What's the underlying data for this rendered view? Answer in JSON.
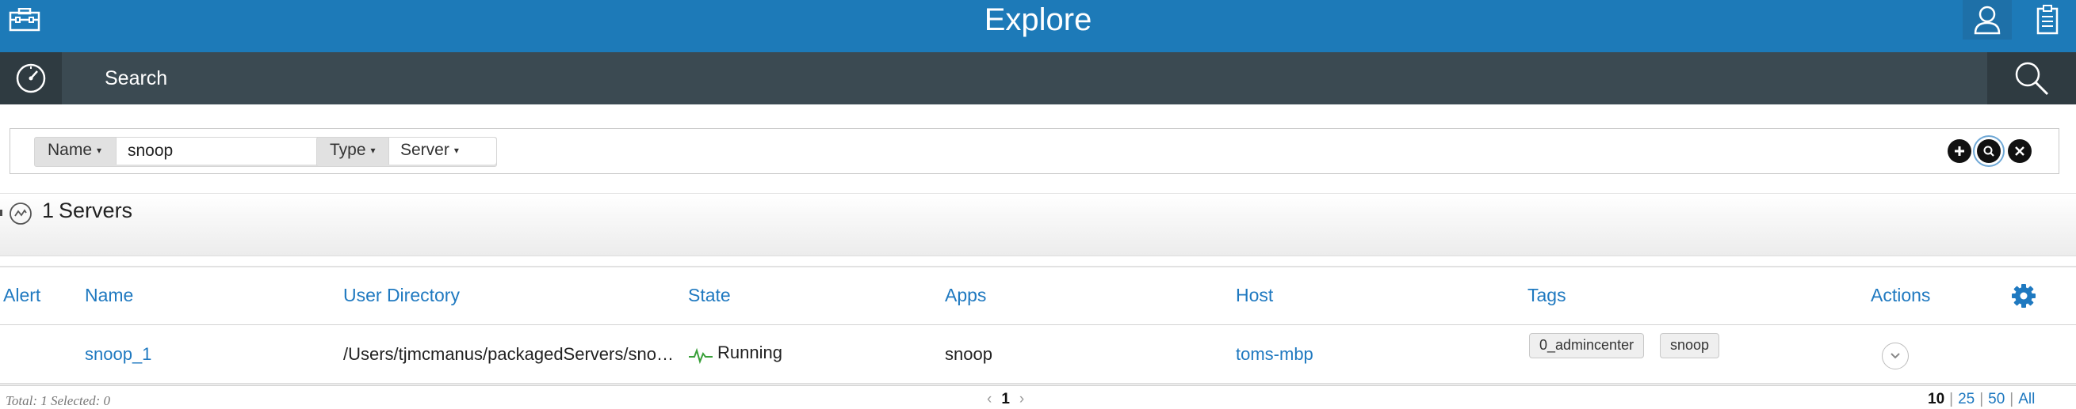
{
  "header": {
    "title": "Explore",
    "left_icon": "toolbox-icon",
    "right_icons": [
      "user-icon",
      "clipboard-icon"
    ],
    "bg_color": "#1d7ab8"
  },
  "subnav": {
    "label": "Search",
    "left_icon": "dashboard-icon",
    "right_icon": "search-icon",
    "bg_color": "#3b4a52"
  },
  "filters": [
    {
      "key": "Name",
      "value": "snoop"
    },
    {
      "key": "Type",
      "value": "Server"
    }
  ],
  "filter_actions": [
    "add-icon",
    "search-icon",
    "close-icon"
  ],
  "group": {
    "count": "1",
    "label": "Servers",
    "icon": "server-group-icon"
  },
  "table": {
    "columns": [
      "Alert",
      "Name",
      "User Directory",
      "State",
      "Apps",
      "Host",
      "Tags",
      "Actions"
    ],
    "rows": [
      {
        "alert": "",
        "name": "snoop_1",
        "user_directory": "/Users/tjmcmanus/packagedServers/snoop/wlp/usr",
        "state": "Running",
        "apps": "snoop",
        "host": "toms-mbp",
        "tags": [
          "0_admincenter",
          "snoop"
        ]
      }
    ],
    "link_color": "#1f79c0",
    "state_color": "#3aa03a"
  },
  "footer": {
    "summary": "Total: 1 Selected: 0",
    "prev": "‹",
    "page": "1",
    "next": "›",
    "page_sizes": [
      "10",
      "25",
      "50",
      "All"
    ],
    "selected_page_size": "10"
  }
}
